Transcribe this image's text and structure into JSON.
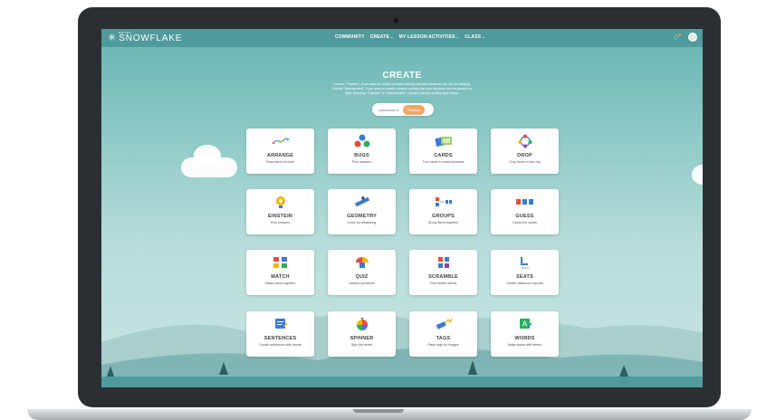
{
  "brand": {
    "small": "BRITES",
    "name": "SNOWFLAKE"
  },
  "nav": {
    "items": [
      {
        "label": "COMMUNITY",
        "dropdown": false
      },
      {
        "label": "CREATE",
        "dropdown": true
      },
      {
        "label": "MY LESSON ACTIVITIES",
        "dropdown": true
      },
      {
        "label": "CLASS",
        "dropdown": true
      }
    ]
  },
  "page": {
    "title": "CREATE",
    "description_lines": [
      "Choose \"Practice\", if you want to create a lesson activity that your students can use for training.",
      "Choose \"Assessment\", if you want to create a lesson activity that your students can be graded on.",
      "After choosing \"Practice\" or \"Assessment\", choose a lesson activity type below."
    ],
    "toggle": {
      "options": [
        "Assessment",
        "Practice"
      ],
      "selected": "Practice"
    }
  },
  "activities": [
    {
      "title": "ARRANGE",
      "desc": "Place items in order",
      "icon": "arrange-icon"
    },
    {
      "title": "BUGS",
      "desc": "Pick answers",
      "icon": "bugs-icon"
    },
    {
      "title": "CARDS",
      "desc": "Turn cards to reveal answers",
      "icon": "cards-icon"
    },
    {
      "title": "DROP",
      "desc": "Drop items in the ring",
      "icon": "drop-icon"
    },
    {
      "title": "EINSTEIN",
      "desc": "Pick answers",
      "icon": "einstein-icon"
    },
    {
      "title": "GEOMETRY",
      "desc": "Learn by measuring",
      "icon": "ruler-icon"
    },
    {
      "title": "GROUPS",
      "desc": "Group items together",
      "icon": "groups-icon"
    },
    {
      "title": "GUESS",
      "desc": "Guess the words",
      "icon": "guess-icon"
    },
    {
      "title": "MATCH",
      "desc": "Match cards together",
      "icon": "match-icon"
    },
    {
      "title": "QUIZ",
      "desc": "Answer questions",
      "icon": "quiz-icon"
    },
    {
      "title": "SCRAMBLE",
      "desc": "Find hidden words",
      "icon": "scramble-icon"
    },
    {
      "title": "SEATS",
      "desc": "Create classroom layouts",
      "icon": "seats-icon"
    },
    {
      "title": "SENTENCES",
      "desc": "Create sentences with words",
      "icon": "sentences-icon"
    },
    {
      "title": "SPINNER",
      "desc": "Spin the wheel",
      "icon": "spinner-icon"
    },
    {
      "title": "TAGS",
      "desc": "Place tags on images",
      "icon": "tags-icon"
    },
    {
      "title": "WORDS",
      "desc": "Make words with letters",
      "icon": "words-icon"
    }
  ],
  "colors": {
    "navbar": "#4f9a9a",
    "accent": "#f3a66a",
    "sky_top": "#66b4b4",
    "text_dark": "#3a3f44"
  }
}
